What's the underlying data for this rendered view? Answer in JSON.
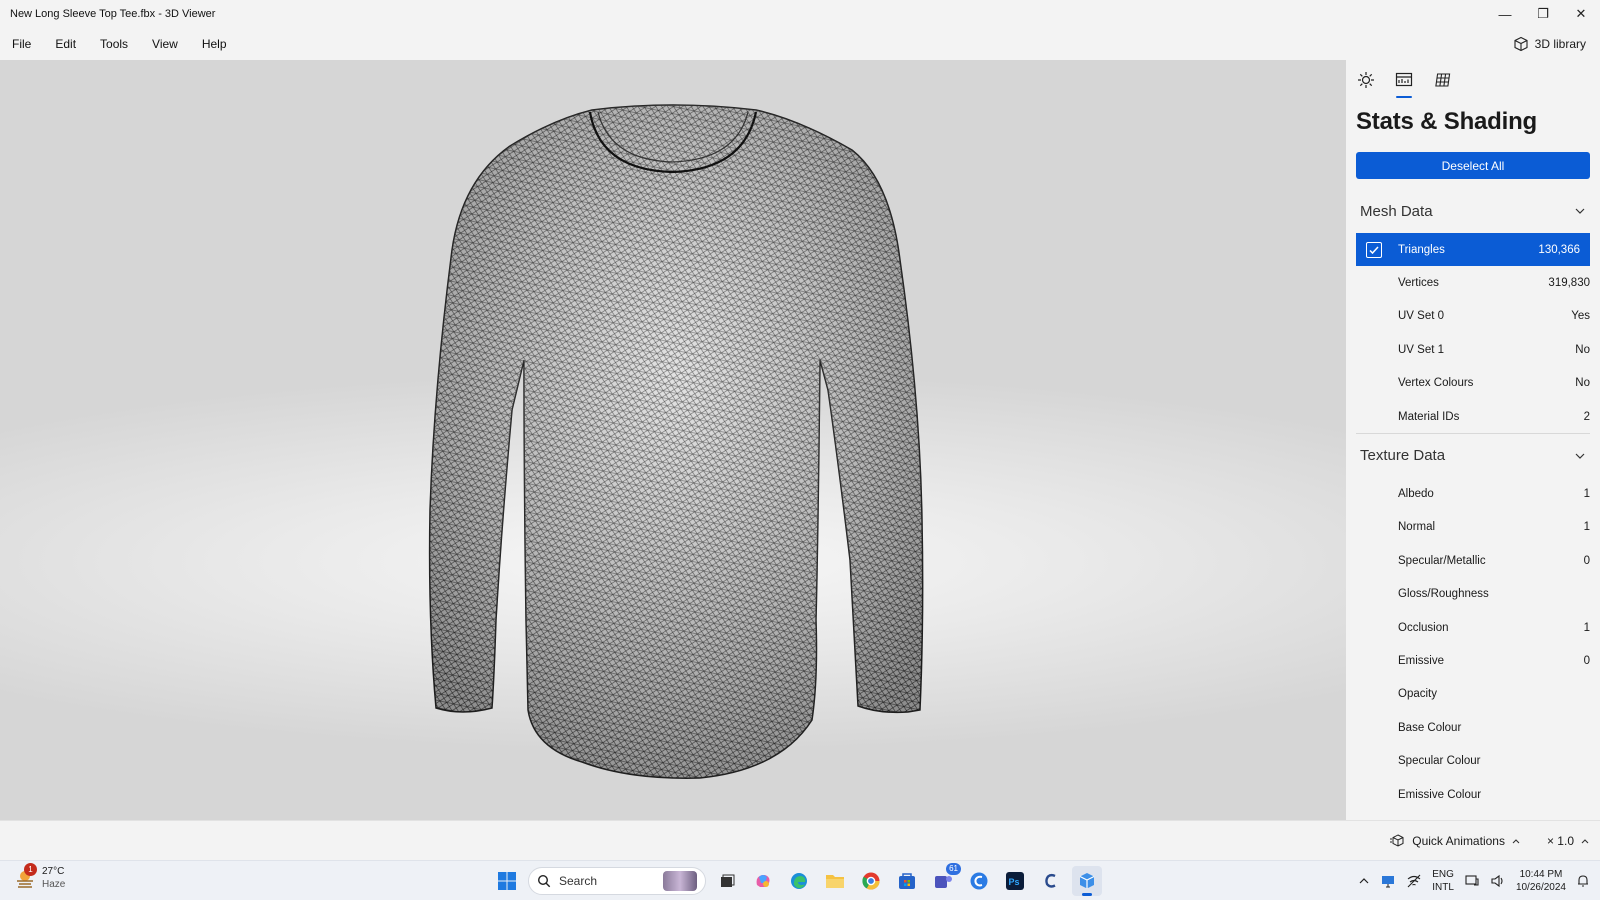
{
  "window": {
    "title": "New Long Sleeve Top Tee.fbx - 3D Viewer",
    "minimize_glyph": "—",
    "restore_glyph": "❐",
    "close_glyph": "✕"
  },
  "menu": {
    "items": [
      "File",
      "Edit",
      "Tools",
      "View",
      "Help"
    ],
    "library_label": "3D library"
  },
  "panel": {
    "tabs": [
      "lighting-icon",
      "stats-icon",
      "grid-icon"
    ],
    "active_tab": "stats-icon",
    "title": "Stats & Shading",
    "deselect_label": "Deselect All",
    "mesh_section": "Mesh Data",
    "mesh_rows": [
      {
        "label": "Triangles",
        "value": "130,366"
      },
      {
        "label": "Vertices",
        "value": "319,830"
      },
      {
        "label": "UV Set 0",
        "value": "Yes"
      },
      {
        "label": "UV Set 1",
        "value": "No"
      },
      {
        "label": "Vertex Colours",
        "value": "No"
      },
      {
        "label": "Material IDs",
        "value": "2"
      }
    ],
    "texture_section": "Texture Data",
    "texture_rows": [
      {
        "label": "Albedo",
        "value": "1"
      },
      {
        "label": "Normal",
        "value": "1"
      },
      {
        "label": "Specular/Metallic",
        "value": "0"
      },
      {
        "label": "Gloss/Roughness",
        "value": ""
      },
      {
        "label": "Occlusion",
        "value": "1"
      },
      {
        "label": "Emissive",
        "value": "0"
      },
      {
        "label": "Opacity",
        "value": ""
      },
      {
        "label": "Base Colour",
        "value": ""
      },
      {
        "label": "Specular Colour",
        "value": ""
      },
      {
        "label": "Emissive Colour",
        "value": ""
      }
    ],
    "accent": "#0b5cd5"
  },
  "bottom": {
    "quick_animations": "Quick Animations",
    "speed": "× 1.0"
  },
  "taskbar": {
    "weather_temp": "27°C",
    "weather_cond": "Haze",
    "weather_badge": "1",
    "search_placeholder": "Search",
    "teams_badge": "61",
    "lang_1": "ENG",
    "lang_2": "INTL",
    "time": "10:44 PM",
    "date": "10/26/2024"
  }
}
